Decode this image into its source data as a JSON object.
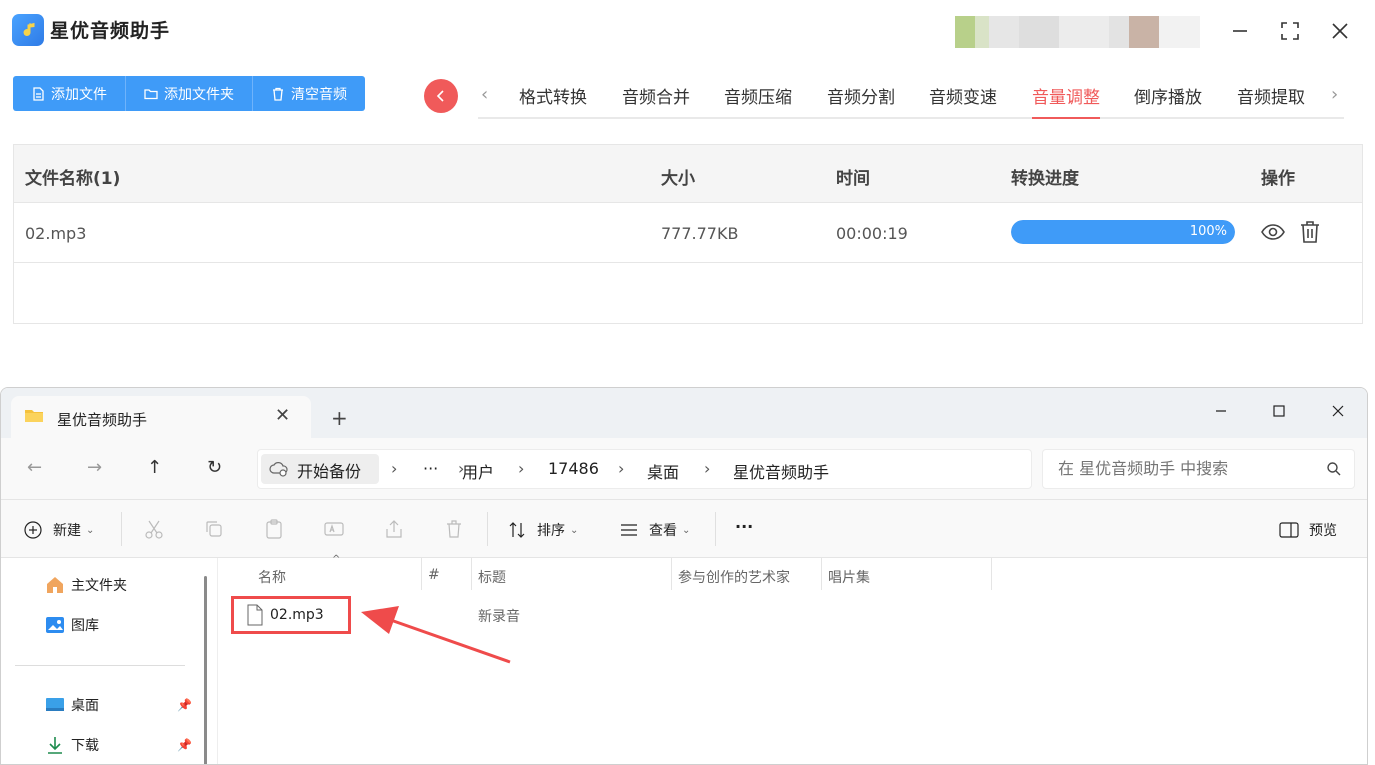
{
  "app": {
    "title": "星优音频助手",
    "toolbar": {
      "add_file": "添加文件",
      "add_folder": "添加文件夹",
      "clear_audio": "清空音频"
    },
    "tabs": [
      {
        "label": "格式转换",
        "active": false
      },
      {
        "label": "音频合并",
        "active": false
      },
      {
        "label": "音频压缩",
        "active": false
      },
      {
        "label": "音频分割",
        "active": false
      },
      {
        "label": "音频变速",
        "active": false
      },
      {
        "label": "音量调整",
        "active": true
      },
      {
        "label": "倒序播放",
        "active": false
      },
      {
        "label": "音频提取",
        "active": false
      }
    ],
    "table": {
      "headers": {
        "name": "文件名称(1)",
        "size": "大小",
        "time": "时间",
        "progress": "转换进度",
        "action": "操作"
      },
      "rows": [
        {
          "name": "02.mp3",
          "size": "777.77KB",
          "time": "00:00:19",
          "progress": 100,
          "progress_label": "100%"
        }
      ]
    },
    "colors": {
      "accent": "#3f9bf8",
      "active_tab": "#f05a5a"
    }
  },
  "explorer": {
    "tab_title": "星优音频助手",
    "breadcrumb": [
      "开始备份",
      "···",
      "用户",
      "17486",
      "桌面",
      "星优音频助手"
    ],
    "search_placeholder": "在 星优音频助手 中搜索",
    "commands": {
      "new": "新建",
      "sort": "排序",
      "view": "查看",
      "more": "···",
      "preview": "预览"
    },
    "sidebar": {
      "home": "主文件夹",
      "gallery": "图库",
      "desktop": "桌面",
      "downloads": "下载"
    },
    "columns": {
      "name": "名称",
      "number": "#",
      "title": "标题",
      "artist": "参与创作的艺术家",
      "album": "唱片集"
    },
    "files": [
      {
        "name": "02.mp3",
        "title": "新录音"
      }
    ]
  }
}
